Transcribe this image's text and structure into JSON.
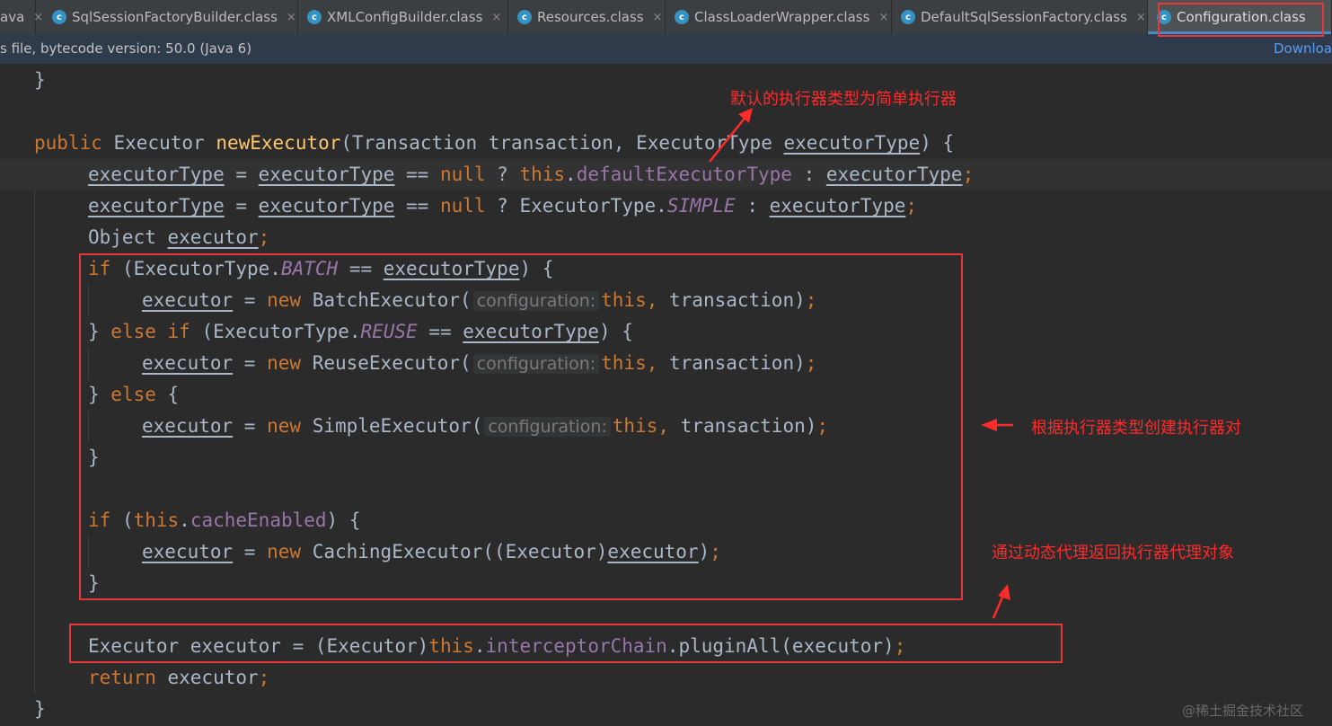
{
  "tabs": [
    {
      "label": "ava",
      "icon": false,
      "active": false
    },
    {
      "label": "SqlSessionFactoryBuilder.class",
      "icon": true,
      "active": false
    },
    {
      "label": "XMLConfigBuilder.class",
      "icon": true,
      "active": false
    },
    {
      "label": "Resources.class",
      "icon": true,
      "active": false
    },
    {
      "label": "ClassLoaderWrapper.class",
      "icon": true,
      "active": false
    },
    {
      "label": "DefaultSqlSessionFactory.class",
      "icon": true,
      "active": false
    },
    {
      "label": "Configuration.class",
      "icon": true,
      "active": true
    }
  ],
  "tab_icon_letter": "c",
  "close_glyph": "×",
  "infobar": {
    "text": "s file, bytecode version: 50.0 (Java 6)",
    "download_link": "Downloa"
  },
  "code": {
    "l_close_prev": "}",
    "l_sig_public": "public",
    "l_sig_type": "Executor",
    "l_sig_name": "newExecutor",
    "l_sig_params": "(Transaction transaction, ExecutorType ",
    "l_sig_param2": "executorType",
    "l_sig_end": ") {",
    "executorType": "executorType",
    "executor": "executor",
    "eq": " = ",
    "eqeq": " == ",
    "null": "null",
    "this": "this",
    "new": "new",
    "if": "if",
    "else": "else",
    "return": "return",
    "q": " ? ",
    "colon": " : ",
    "semi": ";",
    "dot": ".",
    "comma": ",",
    "defaultExecutorType": "defaultExecutorType",
    "et_simple_prefix": "ExecutorType.",
    "SIMPLE": "SIMPLE",
    "BATCH": "BATCH",
    "REUSE": "REUSE",
    "l5_object": "Object ",
    "l6_paren_open": " (ExecutorType.",
    "close_paren_brace": ") {",
    "BatchExecutor": "BatchExecutor(",
    "ReuseExecutor": "ReuseExecutor(",
    "SimpleExecutor": "SimpleExecutor(",
    "hint_configuration": "configuration:",
    "transaction_end": " transaction)",
    "close_brace": "}",
    "close_brace_else_if_start": "} ",
    "else_if_space": " ",
    "open_brace_only": " {",
    "if_this_open": " (",
    "cacheEnabled": "cacheEnabled",
    "cache_close": ") {",
    "CachingExecutor": "CachingExecutor((Executor)",
    "caching_end": ")",
    "l_plugin_start": "Executor executor = (Executor)",
    "interceptorChain": "interceptorChain",
    "pluginAll": ".pluginAll(executor)",
    "return_rest": " executor",
    "final_brace": "}"
  },
  "annotations": {
    "top": "默认的执行器类型为简单执行器",
    "middle": "根据执行器类型创建执行器对",
    "bottom": "通过动态代理返回执行器代理对象"
  },
  "watermark": "@稀土掘金技术社区",
  "colors": {
    "annotation_red": "#ff2a2a",
    "keyword": "#cc7832",
    "method": "#ffc66d",
    "field": "#9876aa",
    "text": "#a9b7c6",
    "background": "#2b2b2b"
  }
}
